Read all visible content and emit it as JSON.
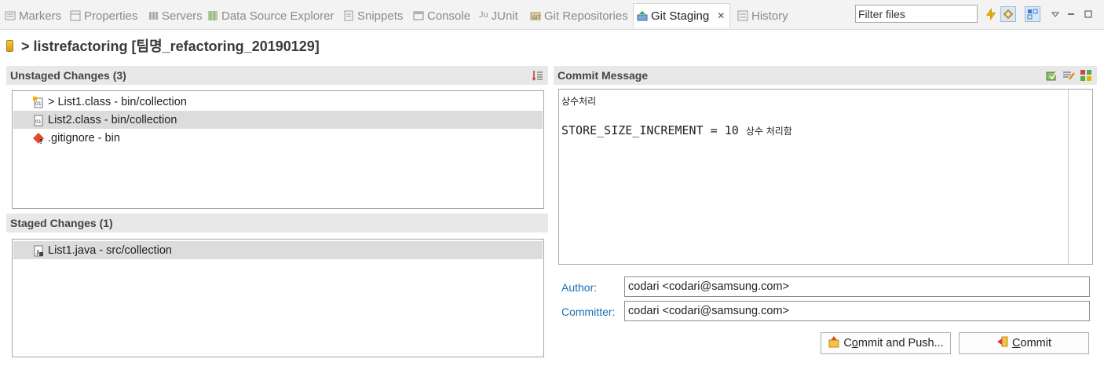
{
  "tabs": [
    {
      "label": "Markers",
      "icon": "markers-icon"
    },
    {
      "label": "Properties",
      "icon": "properties-icon"
    },
    {
      "label": "Servers",
      "icon": "servers-icon"
    },
    {
      "label": "Data Source Explorer",
      "icon": "data-source-icon"
    },
    {
      "label": "Snippets",
      "icon": "snippets-icon"
    },
    {
      "label": "Console",
      "icon": "console-icon"
    },
    {
      "label": "JUnit",
      "icon": "junit-icon"
    },
    {
      "label": "Git Repositories",
      "icon": "git-repositories-icon"
    },
    {
      "label": "Git Staging",
      "icon": "git-staging-icon",
      "active": true
    },
    {
      "label": "History",
      "icon": "history-icon"
    }
  ],
  "filter": {
    "placeholder": "Filter files"
  },
  "repo": {
    "title": "> listrefactoring [팀명_refactoring_20190129]"
  },
  "unstaged": {
    "header": "Unstaged Changes (3)",
    "items": [
      {
        "label": "> List1.class - bin/collection",
        "icon": "class-file-modified-icon"
      },
      {
        "label": "List2.class - bin/collection",
        "icon": "class-file-icon",
        "selected": true
      },
      {
        "label": ".gitignore - bin",
        "icon": "gitignore-file-icon"
      }
    ]
  },
  "staged": {
    "header": "Staged Changes (1)",
    "items": [
      {
        "label": "List1.java - src/collection",
        "icon": "java-file-icon",
        "selected": true
      }
    ]
  },
  "commit": {
    "header": "Commit Message",
    "message_line1": "상수처리",
    "message_line2_code": "STORE_SIZE_INCREMENT = 10",
    "message_line2_kr": "상수 처리함",
    "author_label": "Author:",
    "author_value": "codari <codari@samsung.com>",
    "committer_label": "Committer:",
    "committer_value": "codari <codari@samsung.com>",
    "commit_push_label_pre": "C",
    "commit_push_label_u": "o",
    "commit_push_label_post": "mmit and Push...",
    "commit_label_u": "C",
    "commit_label_post": "ommit"
  },
  "colors": {
    "link": "#1a6fb5",
    "selection": "#dcdcdc",
    "header_bg": "#e8e8e8"
  }
}
